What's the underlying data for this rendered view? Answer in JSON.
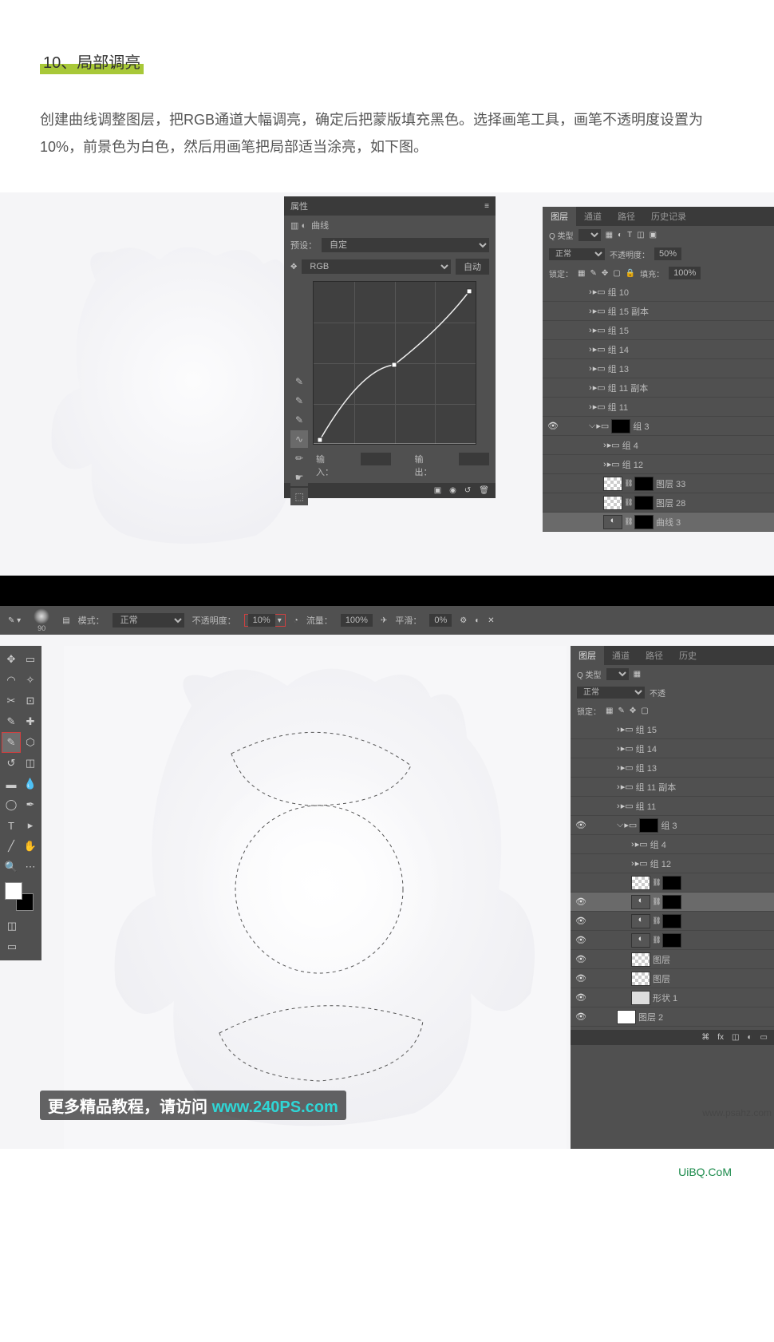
{
  "heading": "10、局部调亮",
  "body_text": "创建曲线调整图层，把RGB通道大幅调亮，确定后把蒙版填充黑色。选择画笔工具，画笔不透明度设置为10%，前景色为白色，然后用画笔把局部适当涂亮，如下图。",
  "props": {
    "title": "属性",
    "type_label": "曲线",
    "preset_label": "预设：",
    "preset_value": "自定",
    "channel_value": "RGB",
    "auto_btn": "自动",
    "input_label": "输入：",
    "output_label": "输出："
  },
  "layers1": {
    "tabs": [
      "图层",
      "通道",
      "路径",
      "历史记录"
    ],
    "kind_label": "Q 类型",
    "blend_value": "正常",
    "opacity_label": "不透明度：",
    "opacity_value": "50%",
    "lock_label": "锁定：",
    "fill_label": "填充：",
    "fill_value": "100%",
    "rows": [
      {
        "vis": "",
        "indent": 1,
        "chev": "›",
        "icon": "folder",
        "label": "组 10"
      },
      {
        "vis": "",
        "indent": 1,
        "chev": "›",
        "icon": "folder",
        "label": "组 15 副本"
      },
      {
        "vis": "",
        "indent": 1,
        "chev": "›",
        "icon": "folder",
        "label": "组 15"
      },
      {
        "vis": "",
        "indent": 1,
        "chev": "›",
        "icon": "folder",
        "label": "组 14"
      },
      {
        "vis": "",
        "indent": 1,
        "chev": "›",
        "icon": "folder",
        "label": "组 13"
      },
      {
        "vis": "",
        "indent": 1,
        "chev": "›",
        "icon": "folder",
        "label": "组 11 副本"
      },
      {
        "vis": "",
        "indent": 1,
        "chev": "›",
        "icon": "folder",
        "label": "组 11"
      },
      {
        "vis": "●",
        "indent": 1,
        "chev": "⌵",
        "icon": "folder-mask",
        "label": "组 3"
      },
      {
        "vis": "",
        "indent": 2,
        "chev": "›",
        "icon": "folder",
        "label": "组 4"
      },
      {
        "vis": "",
        "indent": 2,
        "chev": "›",
        "icon": "folder",
        "label": "组 12"
      },
      {
        "vis": "",
        "indent": 2,
        "icon": "layer-mask",
        "label": "图层 33"
      },
      {
        "vis": "",
        "indent": 2,
        "icon": "layer-mask",
        "label": "图层 28"
      },
      {
        "vis": "",
        "indent": 2,
        "icon": "adj-mask",
        "label": "曲线 3",
        "sel": true
      }
    ]
  },
  "optbar": {
    "brush_size": "90",
    "mode_label": "模式：",
    "mode_value": "正常",
    "opacity_label": "不透明度：",
    "opacity_value": "10%",
    "flow_label": "流量：",
    "flow_value": "100%",
    "smooth_label": "平滑：",
    "smooth_value": "0%"
  },
  "layers2": {
    "tabs": [
      "图层",
      "通道",
      "路径",
      "历史"
    ],
    "kind_label": "Q 类型",
    "blend_value": "正常",
    "opacity_label": "不透",
    "lock_label": "锁定：",
    "rows": [
      {
        "vis": "",
        "indent": 1,
        "chev": "›",
        "icon": "folder",
        "label": "组 15"
      },
      {
        "vis": "",
        "indent": 1,
        "chev": "›",
        "icon": "folder",
        "label": "组 14"
      },
      {
        "vis": "",
        "indent": 1,
        "chev": "›",
        "icon": "folder",
        "label": "组 13"
      },
      {
        "vis": "",
        "indent": 1,
        "chev": "›",
        "icon": "folder",
        "label": "组 11 副本"
      },
      {
        "vis": "",
        "indent": 1,
        "chev": "›",
        "icon": "folder",
        "label": "组 11"
      },
      {
        "vis": "●",
        "indent": 1,
        "chev": "⌵",
        "icon": "folder-mask",
        "label": "组 3"
      },
      {
        "vis": "",
        "indent": 2,
        "chev": "›",
        "icon": "folder",
        "label": "组 4"
      },
      {
        "vis": "",
        "indent": 2,
        "chev": "›",
        "icon": "folder",
        "label": "组 12"
      },
      {
        "vis": "",
        "indent": 2,
        "icon": "layer-mask",
        "label": ""
      },
      {
        "vis": "●",
        "indent": 2,
        "icon": "adj-mask",
        "label": "",
        "sel": true
      },
      {
        "vis": "●",
        "indent": 2,
        "icon": "adj-mask",
        "label": ""
      },
      {
        "vis": "●",
        "indent": 2,
        "icon": "adj-mask",
        "label": ""
      },
      {
        "vis": "●",
        "indent": 2,
        "icon": "layer",
        "label": "图层"
      },
      {
        "vis": "●",
        "indent": 2,
        "icon": "layer",
        "label": "图层"
      },
      {
        "vis": "●",
        "indent": 2,
        "icon": "shape",
        "label": "形状 1"
      },
      {
        "vis": "●",
        "indent": 1,
        "icon": "layer-white",
        "label": "图层 2"
      }
    ]
  },
  "watermark": {
    "prefix": "更多精品教程，请访问 ",
    "link": "www.240PS.com",
    "right": "UiBQ.CoM",
    "faint": "www.psahz.com"
  }
}
